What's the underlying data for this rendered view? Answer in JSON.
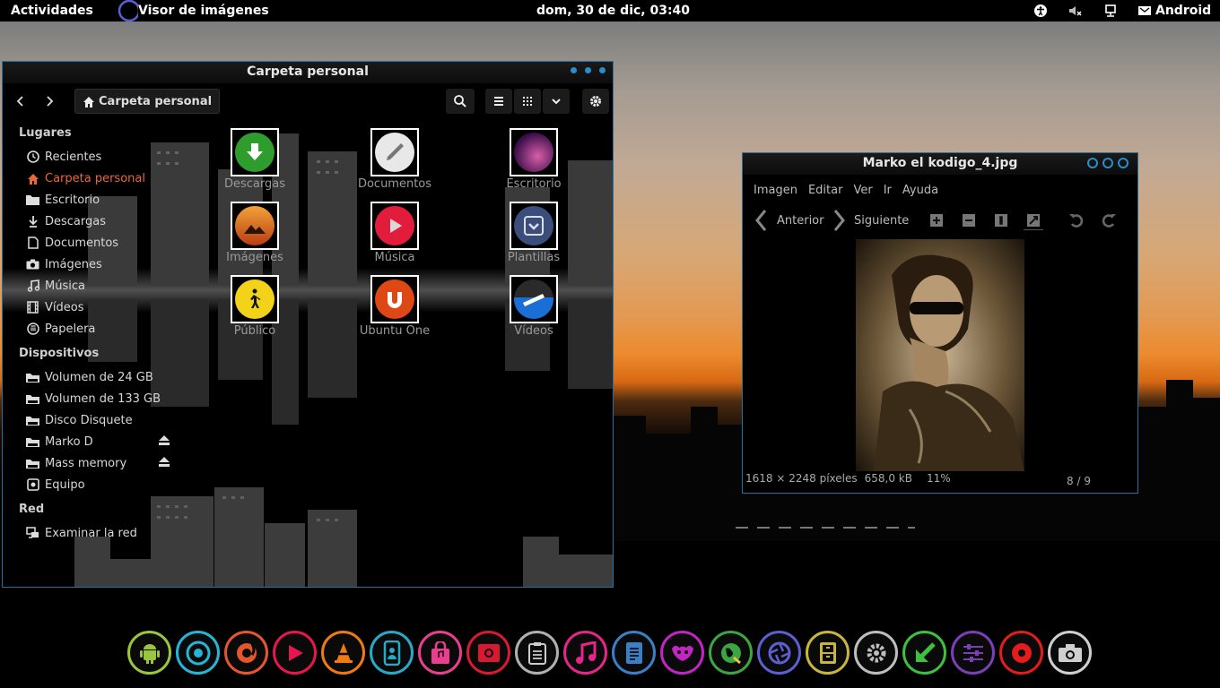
{
  "topbar": {
    "activities": "Actividades",
    "app": "Visor de imágenes",
    "clock": "dom, 30 de dic, 03:40",
    "user": "Android"
  },
  "file_manager": {
    "title": "Carpeta personal",
    "path": "Carpeta personal",
    "sidebar": {
      "places_header": "Lugares",
      "places": [
        {
          "label": "Recientes",
          "icon": "clock-icon"
        },
        {
          "label": "Carpeta personal",
          "icon": "home-icon"
        },
        {
          "label": "Escritorio",
          "icon": "folder-icon"
        },
        {
          "label": "Descargas",
          "icon": "download-icon"
        },
        {
          "label": "Documentos",
          "icon": "document-icon"
        },
        {
          "label": "Imágenes",
          "icon": "camera-icon"
        },
        {
          "label": "Música",
          "icon": "music-icon"
        },
        {
          "label": "Vídeos",
          "icon": "film-icon"
        },
        {
          "label": "Papelera",
          "icon": "trash-icon"
        }
      ],
      "devices_header": "Dispositivos",
      "devices": [
        {
          "label": "Volumen de 24 GB",
          "icon": "drive-icon"
        },
        {
          "label": "Volumen de 133 GB",
          "icon": "drive-icon"
        },
        {
          "label": "Disco Disquete",
          "icon": "drive-icon"
        },
        {
          "label": "Marko D",
          "icon": "drive-icon"
        },
        {
          "label": "Mass memory",
          "icon": "drive-icon"
        },
        {
          "label": "Equipo",
          "icon": "computer-icon"
        }
      ],
      "network_header": "Red",
      "network": [
        {
          "label": "Examinar la red",
          "icon": "network-icon"
        }
      ]
    },
    "folders": [
      {
        "label": "Descargas",
        "color": "#2e9d2e"
      },
      {
        "label": "Documentos",
        "color": "#e8e8e8"
      },
      {
        "label": "Escritorio",
        "color": "#6a1b6e"
      },
      {
        "label": "Imágenes",
        "color": "#e0741f"
      },
      {
        "label": "Música",
        "color": "#e21d3b"
      },
      {
        "label": "Plantillas",
        "color": "#3b4d7a"
      },
      {
        "label": "Público",
        "color": "#f3d21a"
      },
      {
        "label": "Ubuntu One",
        "color": "#dd4814"
      },
      {
        "label": "Vídeos",
        "color": "#1a6fd6"
      }
    ]
  },
  "image_viewer": {
    "title": "Marko el kodigo_4.jpg",
    "menu": [
      "Imagen",
      "Editar",
      "Ver",
      "Ir",
      "Ayuda"
    ],
    "prev": "Anterior",
    "next": "Siguiente",
    "dimensions": "1618 × 2248 píxeles",
    "filesize": "658,0 kB",
    "zoom": "11%",
    "pager": "8 / 9"
  },
  "dock": [
    {
      "name": "android",
      "color": "#9bc53d"
    },
    {
      "name": "chrome",
      "color": "#27b5d6"
    },
    {
      "name": "firefox",
      "color": "#e4572e"
    },
    {
      "name": "play-store",
      "color": "#e5174e"
    },
    {
      "name": "vlc",
      "color": "#f07a12"
    },
    {
      "name": "contacts",
      "color": "#27a9c8"
    },
    {
      "name": "software-center",
      "color": "#e93f8e"
    },
    {
      "name": "photo-booth",
      "color": "#d71a31"
    },
    {
      "name": "notes",
      "color": "#b0b0b0"
    },
    {
      "name": "music",
      "color": "#e4268a"
    },
    {
      "name": "documents",
      "color": "#3b7fc4"
    },
    {
      "name": "gimp",
      "color": "#c226c2"
    },
    {
      "name": "browser",
      "color": "#3ba641"
    },
    {
      "name": "shotwell",
      "color": "#5b5fd1"
    },
    {
      "name": "archive",
      "color": "#c9b53b"
    },
    {
      "name": "settings",
      "color": "#bdbdbd"
    },
    {
      "name": "download",
      "color": "#3fbf3f"
    },
    {
      "name": "mixer",
      "color": "#7a3fb8"
    },
    {
      "name": "recorder",
      "color": "#e41c1c"
    },
    {
      "name": "camera",
      "color": "#cfcfcf"
    }
  ]
}
